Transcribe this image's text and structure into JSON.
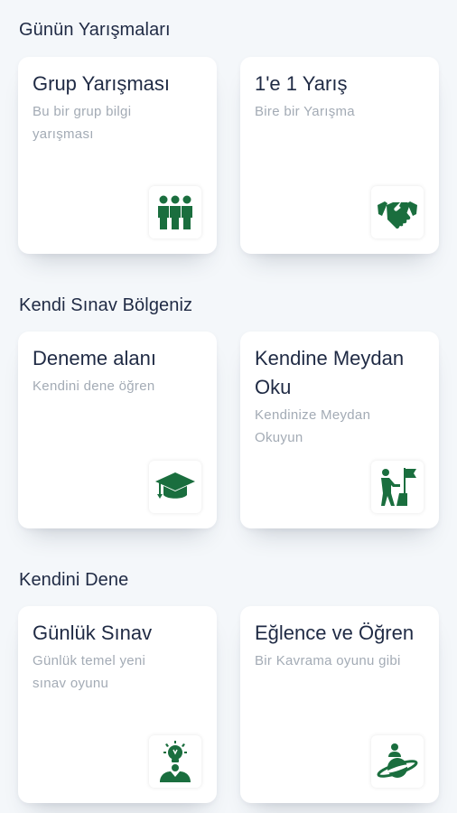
{
  "accent_color": "#1a6e3e",
  "sections": [
    {
      "title": "Günün Yarışmaları",
      "cards": [
        {
          "title": "Grup Yarışması",
          "subtitle": "Bu bir grup bilgi yarışması",
          "icon": "group-people-icon"
        },
        {
          "title": "1'e 1 Yarış",
          "subtitle": "Bire bir Yarışma",
          "icon": "handshake-icon"
        }
      ]
    },
    {
      "title": "Kendi Sınav Bölgeniz",
      "cards": [
        {
          "title": "Deneme alanı",
          "subtitle": "Kendini dene öğren",
          "icon": "graduation-cap-icon"
        },
        {
          "title": "Kendine Meydan Oku",
          "subtitle": "Kendinize Meydan Okuyun",
          "icon": "flag-climb-icon"
        }
      ]
    },
    {
      "title": "Kendini Dene",
      "cards": [
        {
          "title": "Günlük Sınav",
          "subtitle": "Günlük temel yeni sınav oyunu",
          "icon": "idea-person-icon"
        },
        {
          "title": "Eğlence ve Öğren",
          "subtitle": "Bir Kavrama oyunu gibi",
          "icon": "planet-person-icon"
        }
      ]
    }
  ]
}
